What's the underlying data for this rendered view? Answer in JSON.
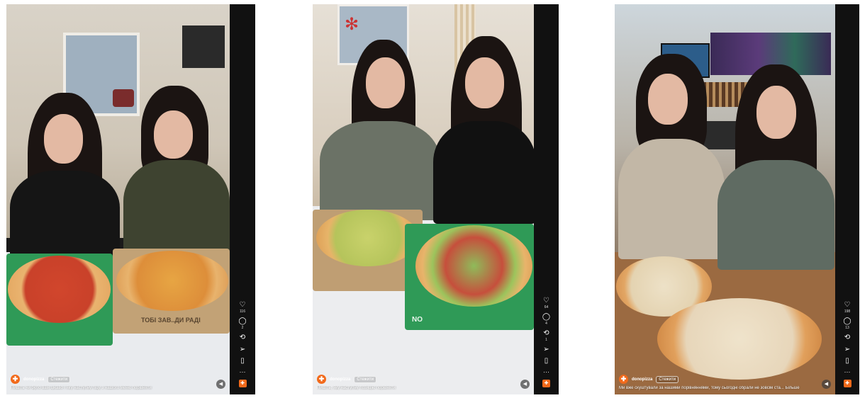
{
  "colors": {
    "brand": "#f26a1b",
    "rail": "#111111",
    "text": "#ffffff"
  },
  "reels": [
    {
      "account": "donopizza",
      "follow_label": "Стежити",
      "caption": "Пишіть чи було вам цікаво і яку наступну піцу з нашого меню порівняти",
      "likes": "116",
      "comments": "2",
      "reposts": "",
      "box_text": "ТОБІ ЗАВ..ДИ РАДІ"
    },
    {
      "account": "donopizza",
      "follow_label": "Стежити",
      "caption": "Пишіть, яку наступну позицію порівняти",
      "likes": "64",
      "comments": "4",
      "reposts": "1",
      "box_text": "NO"
    },
    {
      "account": "donopizza",
      "follow_label": "Стежити",
      "caption": "Ми вже скуштували за нашими порівняннями, тому сьогодні обрали не зовсім ста... Більше",
      "likes": "198",
      "comments": "13",
      "reposts": "",
      "box_text": ""
    }
  ],
  "icons": {
    "like": "heart-icon",
    "comment": "comment-icon",
    "repost": "repost-icon",
    "share": "send-icon",
    "save": "bookmark-icon",
    "more": "more-icon",
    "mute": "mute-icon"
  }
}
